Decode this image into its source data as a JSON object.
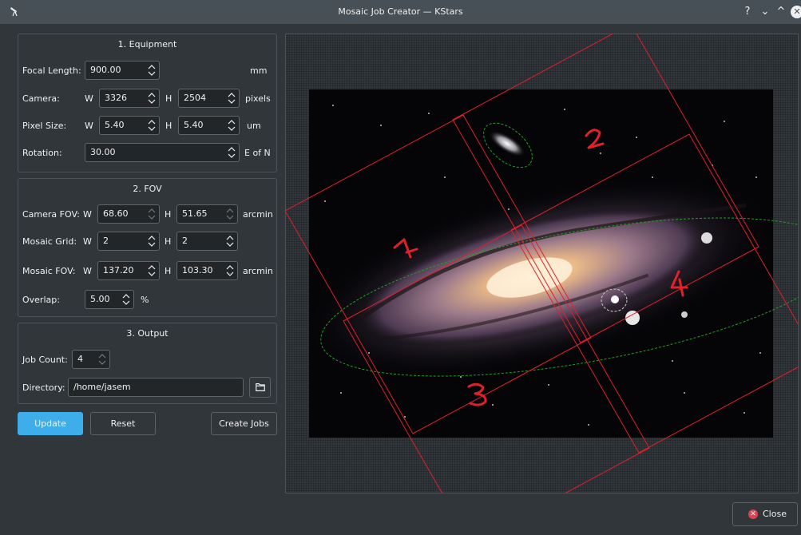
{
  "window": {
    "title": "Mosaic Job Creator — KStars",
    "help_glyph": "?",
    "minimize_glyph": "⌄",
    "maximize_glyph": "^",
    "close_glyph": "✕"
  },
  "equipment": {
    "title": "1. Equipment",
    "focal_length_label": "Focal Length:",
    "focal_length_value": "900.00",
    "focal_length_unit": "mm",
    "camera_label": "Camera:",
    "camera_w_label": "W",
    "camera_w_value": "3326",
    "camera_h_label": "H",
    "camera_h_value": "2504",
    "camera_unit": "pixels",
    "pixel_size_label": "Pixel Size:",
    "pixel_w_label": "W",
    "pixel_w_value": "5.40",
    "pixel_h_label": "H",
    "pixel_h_value": "5.40",
    "pixel_unit": "um",
    "rotation_label": "Rotation:",
    "rotation_value": "30.00",
    "rotation_unit": "E of N"
  },
  "fov": {
    "title": "2. FOV",
    "camera_fov_label": "Camera FOV:",
    "camera_fov_w_label": "W",
    "camera_fov_w_value": "68.60",
    "camera_fov_h_label": "H",
    "camera_fov_h_value": "51.65",
    "camera_fov_unit": "arcmin",
    "mosaic_grid_label": "Mosaic Grid:",
    "mosaic_grid_w_label": "W",
    "mosaic_grid_w_value": "2",
    "mosaic_grid_h_label": "H",
    "mosaic_grid_h_value": "2",
    "mosaic_fov_label": "Mosaic FOV:",
    "mosaic_fov_w_label": "W",
    "mosaic_fov_w_value": "137.20",
    "mosaic_fov_h_label": "H",
    "mosaic_fov_h_value": "103.30",
    "mosaic_fov_unit": "arcmin",
    "overlap_label": "Overlap:",
    "overlap_value": "5.00",
    "overlap_unit": "%"
  },
  "output": {
    "title": "3. Output",
    "job_count_label": "Job Count:",
    "job_count_value": "4",
    "directory_label": "Directory:",
    "directory_value": "/home/jasem"
  },
  "buttons": {
    "update": "Update",
    "reset": "Reset",
    "create_jobs": "Create Jobs",
    "close": "Close"
  },
  "canvas": {
    "tile_labels": [
      "1",
      "2",
      "3",
      "4"
    ],
    "tile_color": "#e0202a",
    "target_color": "#1fa01f"
  },
  "colors": {
    "accent": "#3daee9",
    "window_bg": "#31363b",
    "titlebar_bg": "#475057"
  }
}
